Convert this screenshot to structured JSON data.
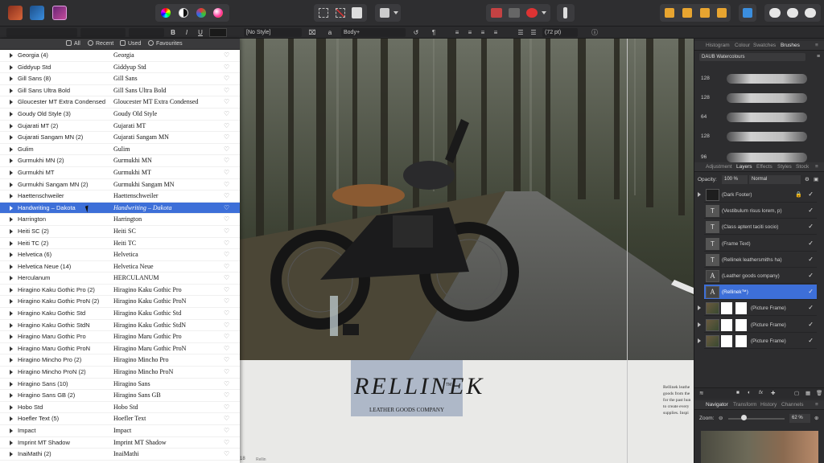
{
  "toolbar": {
    "colors": {
      "accent": "#3d6fd8",
      "brand_pink": "#c24b9a",
      "brand_blue": "#3b8ede",
      "brand_orange": "#d8663a"
    },
    "icons": [
      "affinity-photo-persona-icon",
      "affinity-designer-persona-icon",
      "affinity-publisher-persona-icon",
      "color-wheel-icon",
      "contrast-icon",
      "color-picker-icon",
      "swatch-icon",
      "frame-icon",
      "crop-icon",
      "text-frame-icon",
      "picture-frame-icon",
      "snap-icon",
      "view-mode-icon",
      "align-icon",
      "arrange-icon",
      "order-icon",
      "layers-arrange-icon",
      "transform-icon",
      "studio-icon",
      "preflight-icon",
      "share-icon"
    ]
  },
  "context": {
    "style_label": "[No Style]",
    "paragraph_style": "Body+",
    "font_size": "(72 pt)",
    "bold": "B",
    "italic": "I",
    "underline": "U"
  },
  "font_panel": {
    "tabs": [
      {
        "label": "All",
        "icon": "all-fonts-icon"
      },
      {
        "label": "Recent",
        "icon": "clock-icon"
      },
      {
        "label": "Used",
        "icon": "document-icon"
      },
      {
        "label": "Favourites",
        "icon": "heart-icon"
      }
    ],
    "fonts": [
      {
        "name": "Georgia (4)",
        "preview": "Georgia"
      },
      {
        "name": "Giddyup Std",
        "preview": "Giddyup Std"
      },
      {
        "name": "Gill Sans (8)",
        "preview": "Gill Sans"
      },
      {
        "name": "Gill Sans Ultra Bold",
        "preview": "Gill Sans Ultra Bold"
      },
      {
        "name": "Gloucester MT Extra Condensed",
        "preview": "Gloucester MT Extra Condensed"
      },
      {
        "name": "Goudy Old Style (3)",
        "preview": "Goudy Old Style"
      },
      {
        "name": "Gujarati MT (2)",
        "preview": "Gujarati MT"
      },
      {
        "name": "Gujarati Sangam MN (2)",
        "preview": "Gujarati Sangam MN"
      },
      {
        "name": "Gulim",
        "preview": "Gulim"
      },
      {
        "name": "Gurmukhi MN (2)",
        "preview": "Gurmukhi MN"
      },
      {
        "name": "Gurmukhi MT",
        "preview": "Gurmukhi MT"
      },
      {
        "name": "Gurmukhi Sangam MN (2)",
        "preview": "Gurmukhi Sangam MN"
      },
      {
        "name": "Haettenschweiler",
        "preview": "Haettenschweiler"
      },
      {
        "name": "Handwriting – Dakota",
        "preview": "Handwriting – Dakota",
        "selected": true
      },
      {
        "name": "Harrington",
        "preview": "Harrington"
      },
      {
        "name": "Heiti SC (2)",
        "preview": "Heiti SC"
      },
      {
        "name": "Heiti TC (2)",
        "preview": "Heiti TC"
      },
      {
        "name": "Helvetica (6)",
        "preview": "Helvetica"
      },
      {
        "name": "Helvetica Neue (14)",
        "preview": "Helvetica Neue"
      },
      {
        "name": "Herculanum",
        "preview": "HERCULANUM"
      },
      {
        "name": "Hiragino Kaku Gothic Pro (2)",
        "preview": "Hiragino Kaku Gothic Pro"
      },
      {
        "name": "Hiragino Kaku Gothic ProN (2)",
        "preview": "Hiragino Kaku Gothic ProN"
      },
      {
        "name": "Hiragino Kaku Gothic Std",
        "preview": "Hiragino Kaku Gothic Std"
      },
      {
        "name": "Hiragino Kaku Gothic StdN",
        "preview": "Hiragino Kaku Gothic StdN"
      },
      {
        "name": "Hiragino Maru Gothic Pro",
        "preview": "Hiragino Maru Gothic Pro"
      },
      {
        "name": "Hiragino Maru Gothic ProN",
        "preview": "Hiragino Maru Gothic ProN"
      },
      {
        "name": "Hiragino Mincho Pro (2)",
        "preview": "Hiragino Mincho Pro"
      },
      {
        "name": "Hiragino Mincho ProN (2)",
        "preview": "Hiragino Mincho ProN"
      },
      {
        "name": "Hiragino Sans (10)",
        "preview": "Hiragino Sans"
      },
      {
        "name": "Hiragino Sans GB (2)",
        "preview": "Hiragino Sans GB"
      },
      {
        "name": "Hobo Std",
        "preview": "Hobo Std"
      },
      {
        "name": "Hoefler Text (5)",
        "preview": "Hoefler Text"
      },
      {
        "name": "Impact",
        "preview": "Impact"
      },
      {
        "name": "Imprint MT Shadow",
        "preview": "Imprint MT Shadow"
      },
      {
        "name": "InaiMathi (2)",
        "preview": "InaiMathi"
      }
    ]
  },
  "canvas": {
    "logo_text": "RELLINEK",
    "logo_tm": "TM",
    "logo_sub": "LEATHER GOODS COMPANY",
    "body_text": [
      "Rellinek leathe",
      "goods from the",
      "for the past hun",
      "to create every",
      "supplies. Inspi"
    ],
    "page_number": "18",
    "footer_word": "Rellin"
  },
  "right_panel": {
    "top_tabs": [
      "Histogram",
      "Colour",
      "Swatches",
      "Brushes"
    ],
    "brush_category": "DAUB Watercolours",
    "brush_sizes": [
      "128",
      "128",
      "64",
      "128",
      "96"
    ],
    "mid_tabs": [
      "Adjustment",
      "Layers",
      "Effects",
      "Styles",
      "Stock"
    ],
    "opacity_label": "Opacity:",
    "opacity_value": "100 %",
    "blend_mode": "Normal",
    "layers": [
      {
        "name": "(Dark Footer)",
        "type": "group",
        "locked": true
      },
      {
        "name": "(Vestibulum risus lorem, p)",
        "type": "text"
      },
      {
        "name": "(Class aptent taciti socio)",
        "type": "text"
      },
      {
        "name": "(Frame Text)",
        "type": "text"
      },
      {
        "name": "(Rellinek leathersmiths ha)",
        "type": "text"
      },
      {
        "name": "(Leather goods company)",
        "type": "art-text"
      },
      {
        "name": "(Rellinek™)",
        "type": "art-text",
        "selected": true
      },
      {
        "name": "(Picture Frame)",
        "type": "picture"
      },
      {
        "name": "(Picture Frame)",
        "type": "picture"
      },
      {
        "name": "(Picture Frame)",
        "type": "picture"
      }
    ],
    "bottom_tabs": [
      "Navigator",
      "Transform",
      "History",
      "Channels"
    ],
    "zoom_label": "Zoom:",
    "zoom_value": "62 %"
  }
}
